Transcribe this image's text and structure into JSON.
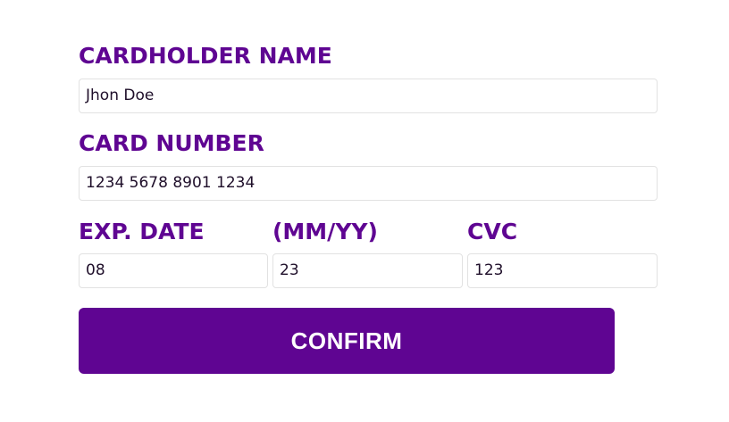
{
  "form": {
    "cardholder_label": "CARDHOLDER NAME",
    "cardholder_value": "Jhon Doe",
    "card_number_label": "CARD NUMBER",
    "card_number_value": "1234 5678 8901 1234",
    "exp_date_label": "EXP. DATE",
    "exp_format_label": "(MM/YY)",
    "exp_month_value": "08",
    "exp_year_value": "23",
    "cvc_label": "CVC",
    "cvc_value": "123",
    "confirm_label": "CONFIRM"
  },
  "colors": {
    "accent": "#5f0592",
    "field_border": "#e2e2e2",
    "field_text": "#1f0f2a",
    "button_text": "#ffffff"
  }
}
